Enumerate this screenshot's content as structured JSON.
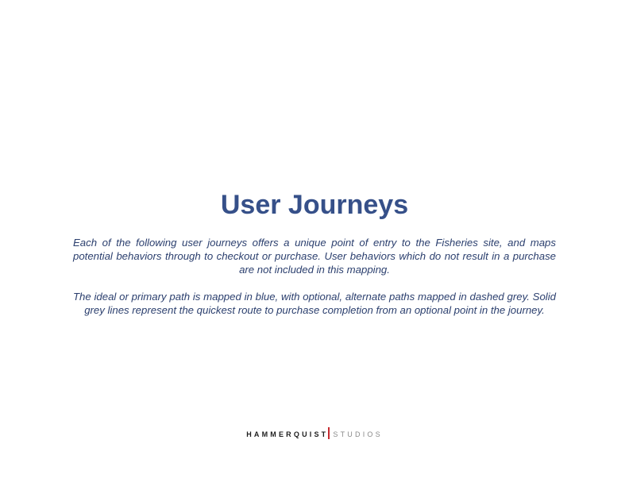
{
  "page": {
    "title": "User Journeys",
    "paragraphs": [
      "Each of the following user journeys offers a unique point of entry to the Fisheries site, and maps potential behaviors through to checkout or purchase. User behaviors which do not result in a purchase are not included in this mapping.",
      "The ideal or primary path is mapped in blue, with optional, alternate paths mapped in dashed grey. Solid grey lines represent the quickest route to purchase completion from an optional point in the journey."
    ]
  },
  "footer": {
    "brand_primary": "HAMMERQUIST",
    "brand_secondary": "STUDIOS"
  },
  "colors": {
    "title": "#365089",
    "body_text": "#2b3f6e",
    "brand_accent": "#c62a2f",
    "brand_primary": "#1e1e1e",
    "brand_secondary": "#8a8a8a"
  }
}
